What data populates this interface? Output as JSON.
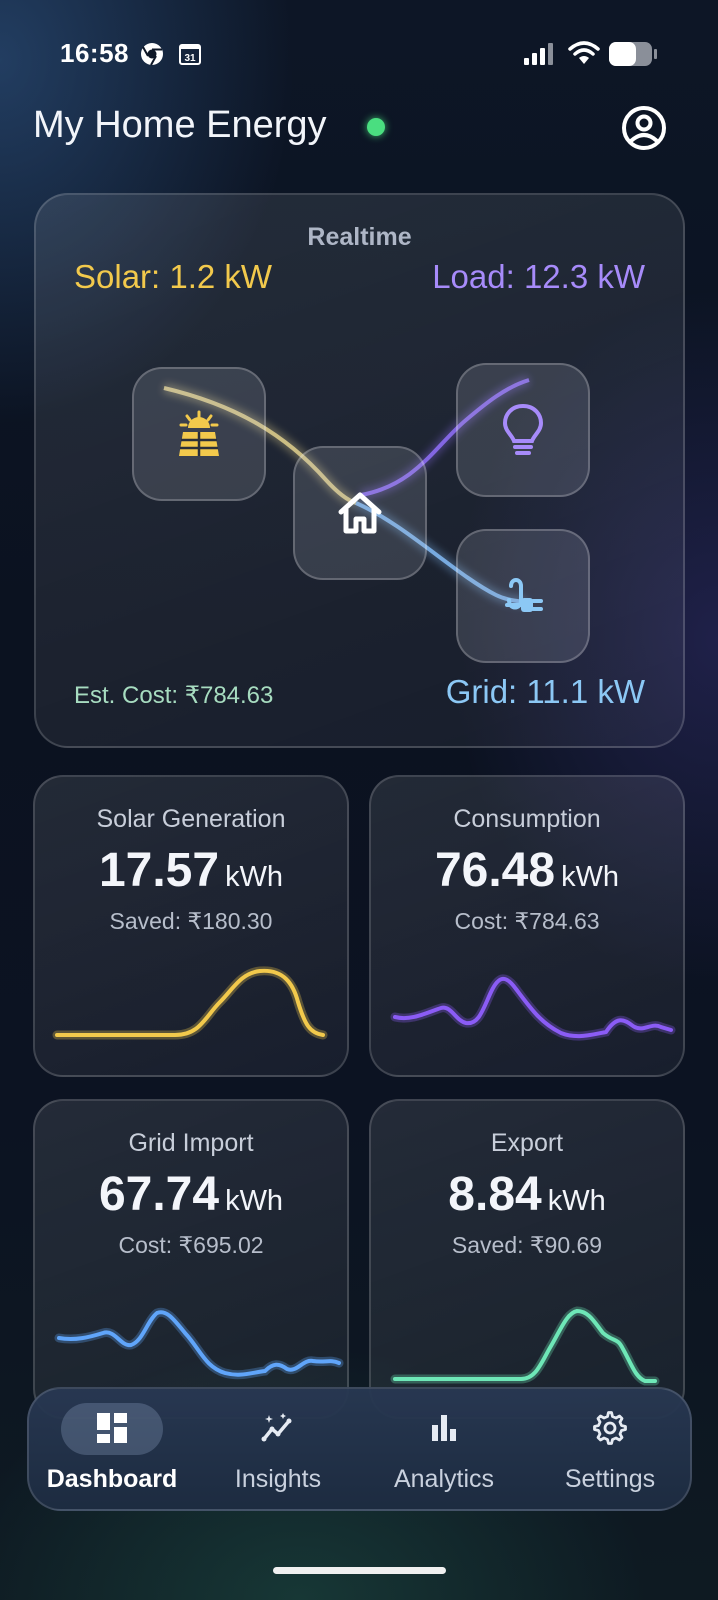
{
  "status_bar": {
    "time": "16:58",
    "icons": [
      "chrome-icon",
      "calendar-icon",
      "signal-icon",
      "wifi-icon",
      "battery-icon"
    ],
    "calendar_day": "31"
  },
  "header": {
    "title": "My Home Energy",
    "status_color": "#4ade80",
    "profile_icon": "account-circle-icon"
  },
  "realtime": {
    "title": "Realtime",
    "solar": "Solar: 1.2 kW",
    "load": "Load: 12.3 kW",
    "est_cost": "Est. Cost: ₹784.63",
    "grid": "Grid: 11.1 kW",
    "nodes": [
      "solar-panel-icon",
      "home-icon",
      "lightbulb-icon",
      "plug-icon"
    ],
    "colors": {
      "solar": "#f2c94c",
      "load": "#a78bfa",
      "grid": "#8cc8f5",
      "cost": "#a7dcc0"
    }
  },
  "cards": {
    "solar": {
      "title": "Solar Generation",
      "value": "17.57",
      "unit": "kWh",
      "sub": "Saved: ₹180.30",
      "color": "#f2c94c"
    },
    "consumption": {
      "title": "Consumption",
      "value": "76.48",
      "unit": "kWh",
      "sub": "Cost: ₹784.63",
      "color": "#8b5cf6"
    },
    "grid_import": {
      "title": "Grid Import",
      "value": "67.74",
      "unit": "kWh",
      "sub": "Cost: ₹695.02",
      "color": "#60a5fa"
    },
    "export": {
      "title": "Export",
      "value": "8.84",
      "unit": "kWh",
      "sub": "Saved: ₹90.69",
      "color": "#6ee7b7"
    }
  },
  "nav": {
    "active": "dashboard",
    "items": [
      {
        "id": "dashboard",
        "label": "Dashboard",
        "icon": "dashboard-icon"
      },
      {
        "id": "insights",
        "label": "Insights",
        "icon": "insights-icon"
      },
      {
        "id": "analytics",
        "label": "Analytics",
        "icon": "bar-chart-icon"
      },
      {
        "id": "settings",
        "label": "Settings",
        "icon": "gear-icon"
      }
    ]
  }
}
